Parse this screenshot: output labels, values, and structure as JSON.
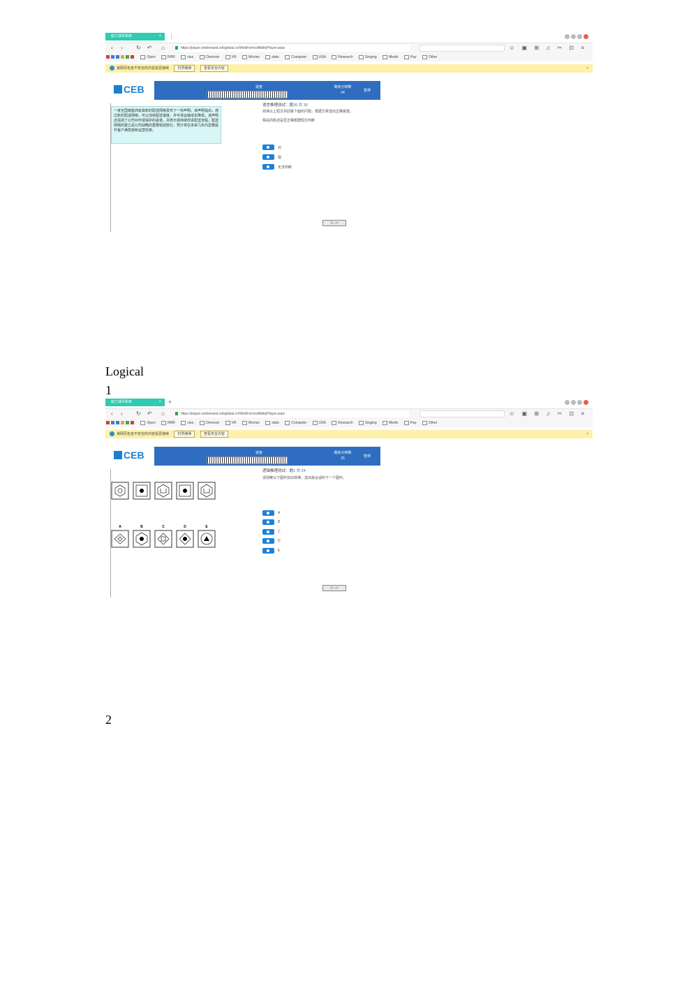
{
  "screenshot1": {
    "tab_title": "能力测评系统",
    "url": "https://player.ondemand.cebglobal.cn/WebForms/AbilityPlayer.aspx",
    "bookmarks": [
      "Open",
      "RRR",
      "visa",
      "Clemson",
      "VR",
      "Movies",
      "stats",
      "Computer",
      "USA",
      "Research",
      "Singing",
      "Mediv",
      "Pay",
      "Other"
    ],
    "infobar_text": "该网页包含不安全的内容是否继续",
    "infobar_btn1": "仍然继续",
    "infobar_btn2": "查看安全内容",
    "logo": "CEB",
    "progress_label": "进度",
    "time_label": "剩余分钟数",
    "time_value": "04",
    "pause_label": "暂停",
    "passage": "一家全国销售商就其新的配送网络发布了一份声明。该声明指出，通过新的配送网络，可以加快配送速度，并可将运输成本降低。该声明还强调了公司对环境保护的承诺，并表示将持续改进配送流程。配送网络的建立是公司战略的重要组成部分，预计将在未来几年内显著提升客户满意度和运营效率。",
    "question_title_prefix": "语言推理测试：题",
    "question_number": "26 共 30",
    "question_line1": "阅读以上短文并回答下面的问题，根据文章选出正确答案。",
    "question_line2": "相关的陈述是否正确根据短文判断",
    "options": [
      "对",
      "错",
      "无法判断"
    ],
    "next_button": "下一个"
  },
  "heading": "Logical",
  "label1": "1",
  "screenshot2": {
    "tab_title": "能力测评系统",
    "url": "https://player.ondemand.cebglobal.cn/WebForms/AbilityPlayer.aspx",
    "bookmarks": [
      "Open",
      "RRR",
      "visa",
      "Clemson",
      "VR",
      "Movies",
      "stats",
      "Computer",
      "USA",
      "Research",
      "Singing",
      "Mediv",
      "Pay",
      "Other"
    ],
    "infobar_text": "该网页包含不安全的内容是否继续",
    "infobar_btn1": "仍然继续",
    "infobar_btn2": "查看安全内容",
    "logo": "CEB",
    "progress_label": "进度",
    "time_label": "剩余分钟数",
    "time_value": "25",
    "pause_label": "暂停",
    "question_title_prefix": "逻辑推理测试：题",
    "question_number": "1 共 24",
    "question_line1": "请观察以下图形找出规律，选出最合适的下一个图形。",
    "answer_letters": [
      "A",
      "B",
      "C",
      "D",
      "E"
    ],
    "options": [
      "A",
      "B",
      "C",
      "D",
      "E"
    ],
    "next_button": "下一个"
  },
  "label2": "2"
}
